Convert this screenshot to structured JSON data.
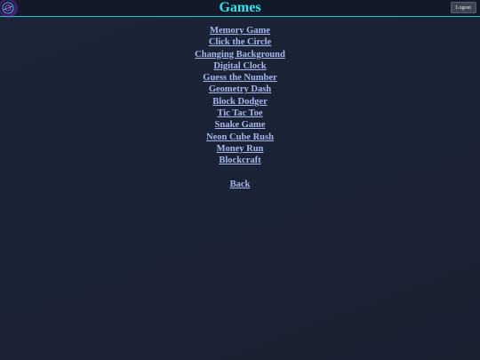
{
  "header": {
    "title": "Games",
    "logout_label": "Logout",
    "logo_icon": "neon-orb-logo-icon",
    "accent_color": "#2ee6f0"
  },
  "games": [
    {
      "label": "Memory Game"
    },
    {
      "label": "Click the Circle"
    },
    {
      "label": "Changing Background"
    },
    {
      "label": "Digital Clock"
    },
    {
      "label": "Guess the Number"
    },
    {
      "label": "Geometry Dash"
    },
    {
      "label": "Block Dodger"
    },
    {
      "label": "Tic Tac Toe"
    },
    {
      "label": "Snake Game"
    },
    {
      "label": "Neon Cube Rush"
    },
    {
      "label": "Money Run"
    },
    {
      "label": "Blockcraft"
    }
  ],
  "footer": {
    "back_label": "Back"
  },
  "colors": {
    "link": "#a7b7ee",
    "background": "#1b2336",
    "header_border": "#22c3d6"
  }
}
